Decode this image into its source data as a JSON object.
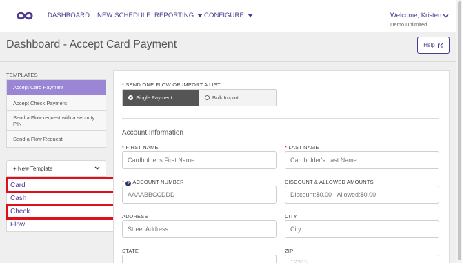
{
  "nav": {
    "items": [
      "DASHBOARD",
      "NEW SCHEDULE",
      "REPORTING",
      "CONFIGURE"
    ],
    "welcome": "Welcome, Kristen",
    "org": "Demo Unlimited"
  },
  "header": {
    "title": "Dashboard - Accept Card Payment",
    "help_label": "Help"
  },
  "sidebar": {
    "templates_label": "TEMPLATES",
    "templates": [
      "Accept Card Payment",
      "Accept Check Payment",
      "Send a Flow request with a security PIN",
      "Send a Flow Request"
    ],
    "new_template_label": "+ New Template",
    "dropdown_items": [
      "Card",
      "Cash",
      "Check",
      "Flow"
    ],
    "highlight_color": "#e0101a"
  },
  "form": {
    "send_label": "SEND ONE FLOW OR IMPORT A LIST",
    "toggle": {
      "single": "Single Payment",
      "bulk": "Bulk Import",
      "selected": "Single Payment"
    },
    "section_title": "Account Information",
    "fields": {
      "first_name": {
        "label": "FIRST NAME",
        "placeholder": "Cardholder's First Name",
        "required": true
      },
      "last_name": {
        "label": "LAST NAME",
        "placeholder": "Cardholder's Last Name",
        "required": true
      },
      "account_number": {
        "label": "ACCOUNT NUMBER",
        "placeholder": "AAAABBCCDDD",
        "required": true
      },
      "discount": {
        "label": "DISCOUNT & ALLOWED AMOUNTS",
        "placeholder": "Discount:$0.00 - Allowed:$0.00"
      },
      "address": {
        "label": "ADDRESS",
        "placeholder": "Street Address"
      },
      "city": {
        "label": "CITY",
        "placeholder": "City"
      },
      "state": {
        "label": "STATE"
      },
      "zip": {
        "label": "ZIP",
        "placeholder": "12345"
      }
    }
  },
  "colors": {
    "brand": "#4f3a8f",
    "active_template": "#9b86d6",
    "required": "#d0021b"
  }
}
